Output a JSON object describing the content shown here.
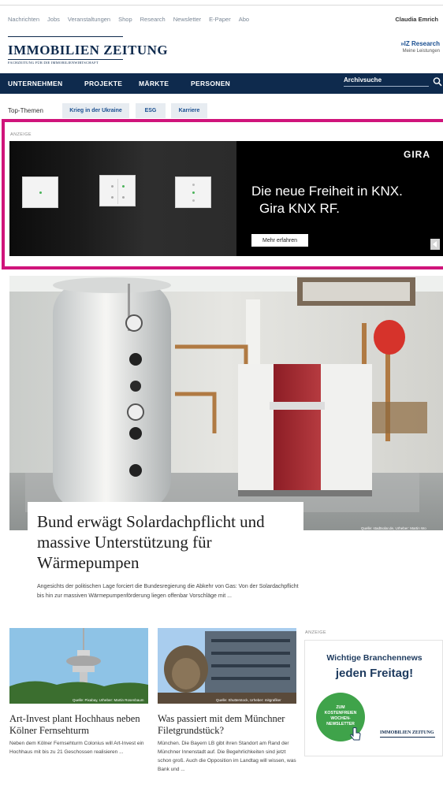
{
  "topnav": {
    "links": [
      "Nachrichten",
      "Jobs",
      "Veranstaltungen",
      "Shop",
      "Research",
      "Newsletter",
      "E-Paper",
      "Abo"
    ],
    "user": "Claudia Emrich"
  },
  "logo": {
    "name": "IMMOBILIEN ZEITUNG",
    "tagline": "FACHZEITUNG FÜR DIE IMMOBILIENWIRTSCHAFT"
  },
  "research": {
    "link": "»IZ Research",
    "sub": "Meine Leistungen"
  },
  "mainnav": {
    "items": [
      "UNTERNEHMEN",
      "PROJEKTE",
      "MÄRKTE",
      "PERSONEN"
    ],
    "archive": "Archivsuche"
  },
  "topics": {
    "label": "Top-Themen",
    "chips": [
      "Krieg in der Ukraine",
      "ESG",
      "Karriere"
    ]
  },
  "ad": {
    "label": "ANZEIGE",
    "brand": "GIRA",
    "headline1": "Die neue Freiheit in KNX.",
    "headline2": "Gira KNX RF.",
    "button": "Mehr erfahren"
  },
  "hero": {
    "credit": "Quelle: stadtsolar.de, Urheber: Martin Wo",
    "title": "Bund erwägt Solardachpflicht und massive Unterstützung für Wärmepumpen",
    "text": "Angesichts der politischen Lage forciert die Bundesregierung die Abkehr von Gas: Von der Solardachpflicht bis hin zur massiven Wärmepumpenförderung liegen offenbar Vorschläge mit ..."
  },
  "teasers": [
    {
      "credit": "Quelle: Pixabay, Urheber: Martin Rosenbaum",
      "title": "Art-Invest plant Hochhaus neben Kölner Fernsehturm",
      "text": "Neben dem Kölner Fernsehturm Colonius will Art-Invest ein Hochhaus mit bis zu 21 Geschossen realisieren ..."
    },
    {
      "credit": "Quelle: Shutterstock, Urheber: mitgrafiker",
      "title": "Was passiert mit dem Münchner Filetgrundstück?",
      "text": "München. Die Bayern LB gibt ihren Standort am Rand der Münchner Innenstadt auf. Die Begehrlichkeiten sind jetzt schon groß. Auch die Opposition im Landtag will wissen, was Bank und ..."
    }
  ],
  "newsletter": {
    "label": "ANZEIGE",
    "line1": "Wichtige Branchennews",
    "line2": "jeden Freitag!",
    "badge": [
      "ZUM",
      "KOSTENFREIEN",
      "WOCHEN-",
      "NEWSLETTER"
    ],
    "logo": "IMMOBILIEN ZEITUNG"
  },
  "colors": {
    "navy": "#0e2a4d",
    "link": "#1a4f91",
    "ad_frame": "#d0147b",
    "newsletter_green": "#3fa34a"
  }
}
